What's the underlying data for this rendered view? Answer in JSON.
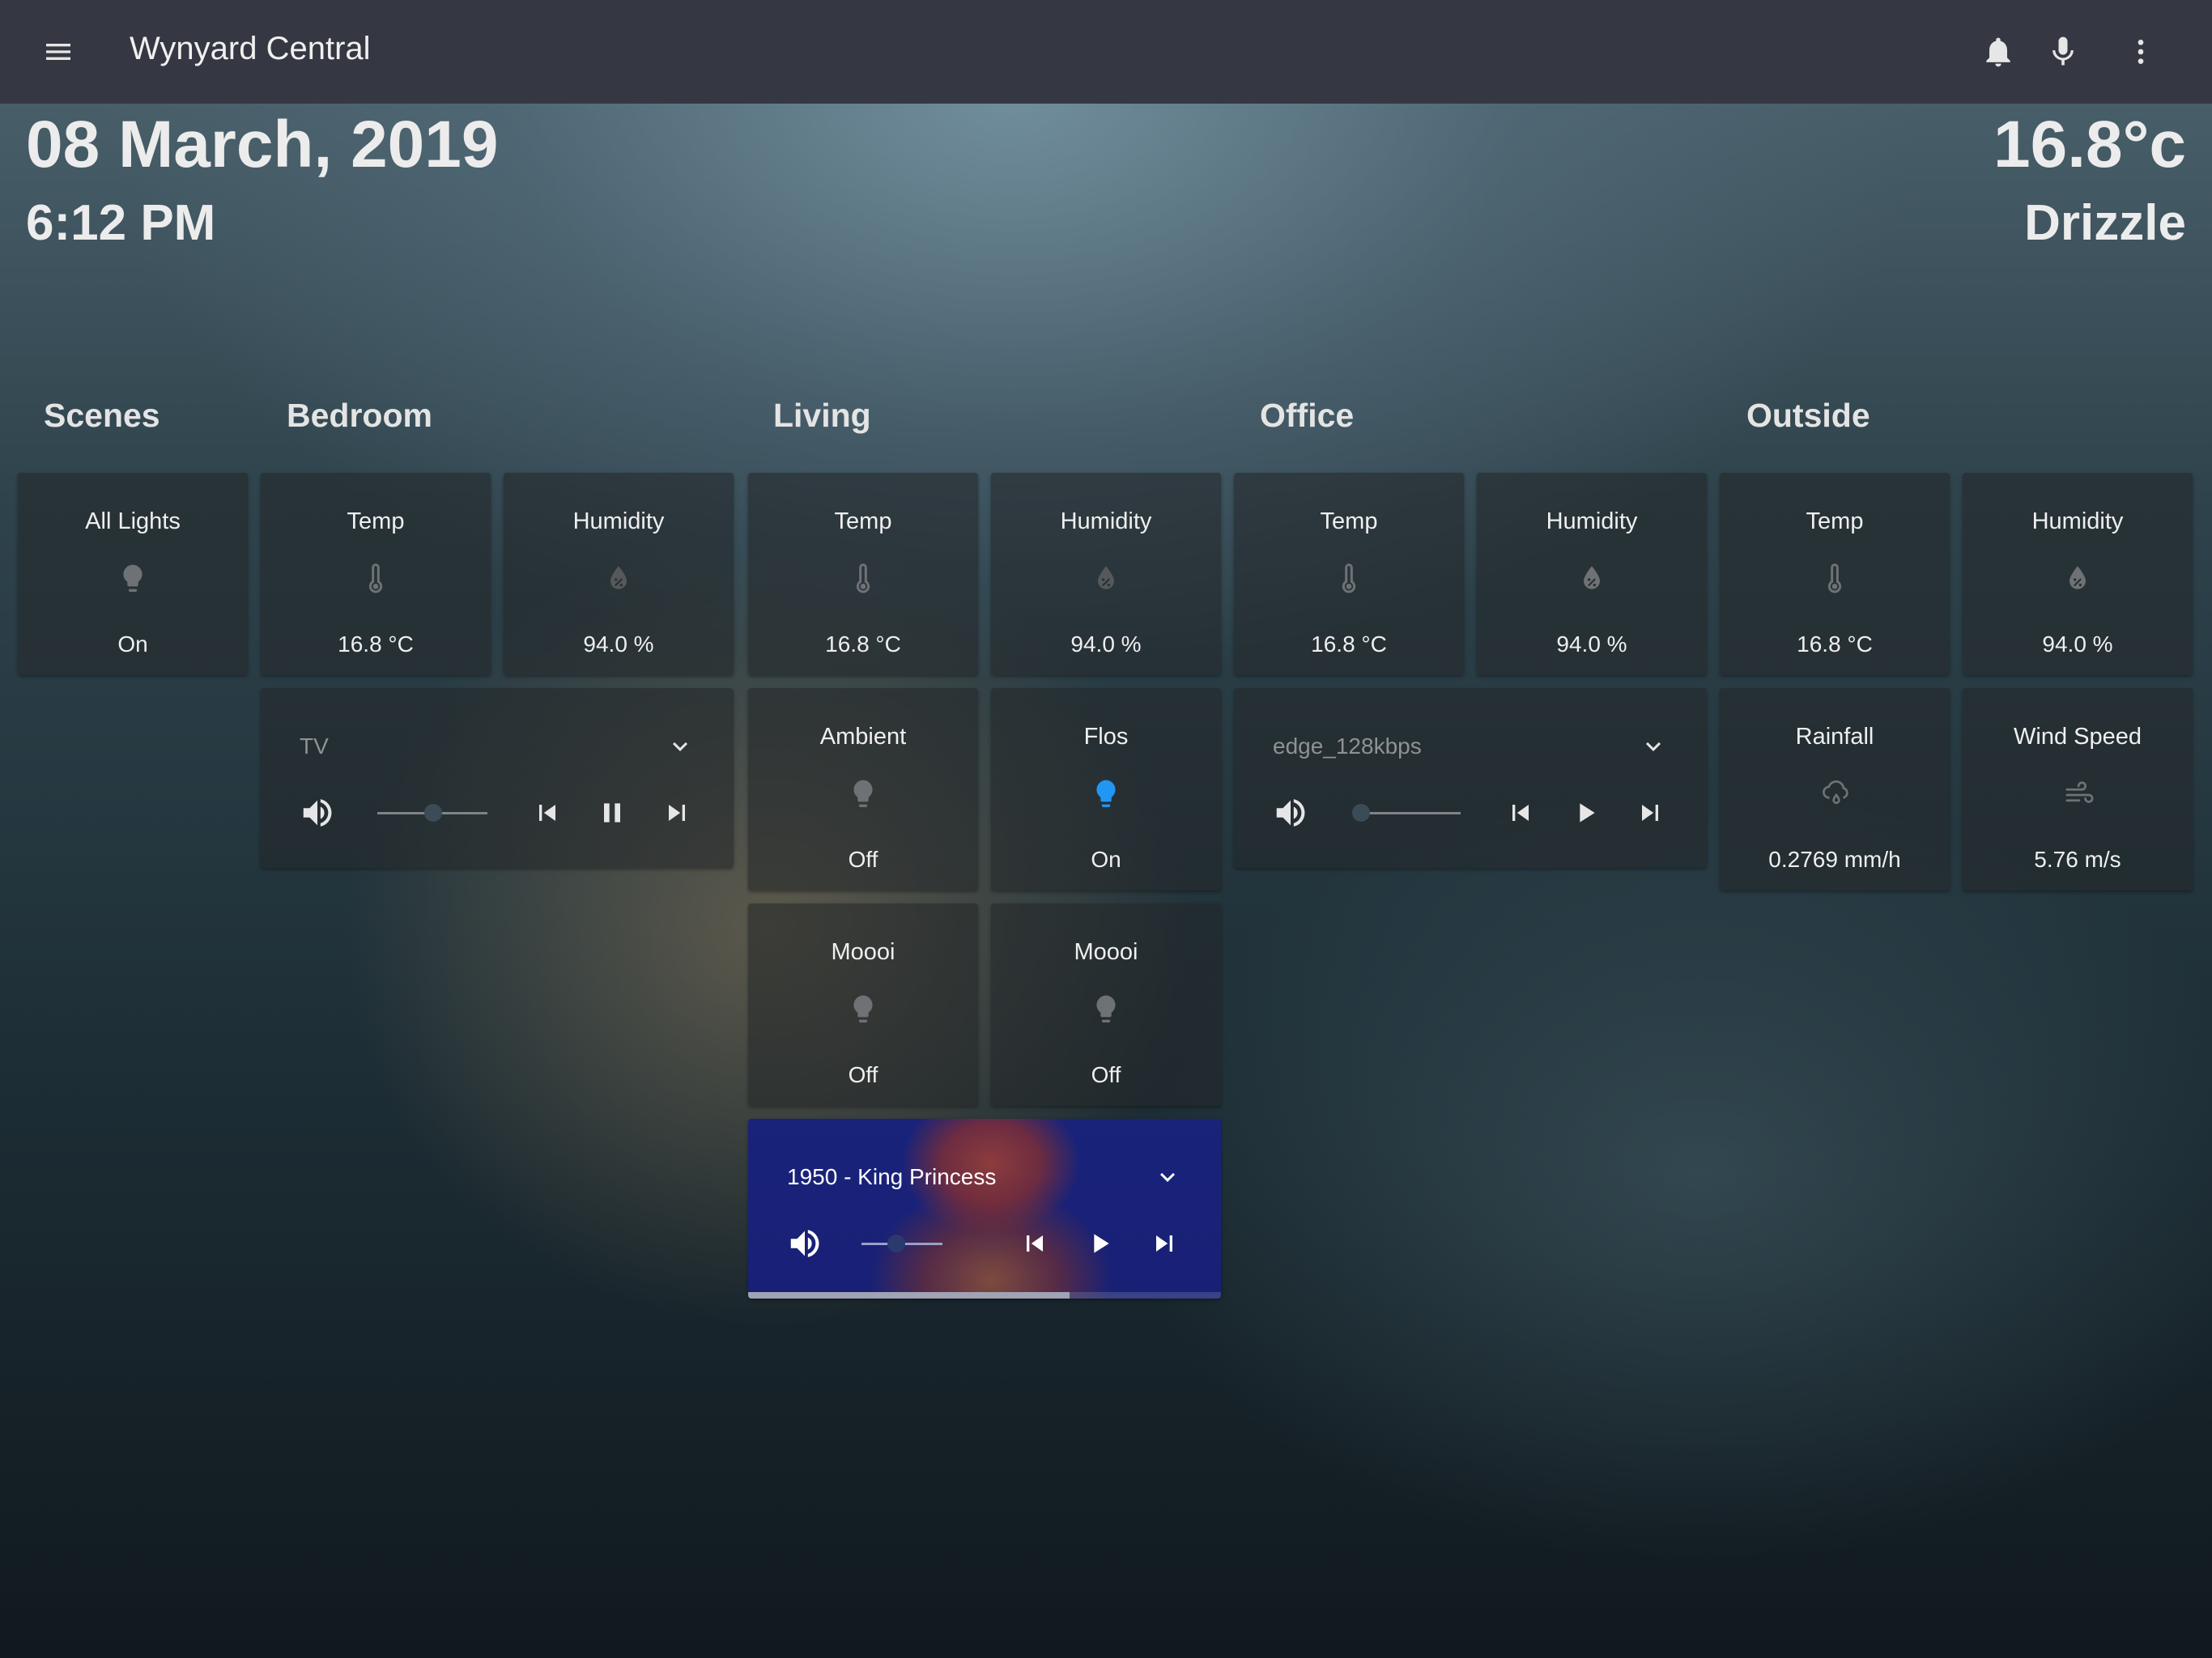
{
  "app": {
    "title": "Wynyard Central"
  },
  "header": {
    "date": "08 March, 2019",
    "time": "6:12 PM",
    "temperature": "16.8°c",
    "condition": "Drizzle"
  },
  "columns": {
    "scenes": "Scenes",
    "bedroom": "Bedroom",
    "living": "Living",
    "office": "Office",
    "outside": "Outside"
  },
  "cards": {
    "all_lights": {
      "name": "All Lights",
      "state": "On",
      "icon": "lightbulb-icon"
    },
    "bedroom_temp": {
      "name": "Temp",
      "state": "16.8 °C",
      "icon": "thermometer-icon"
    },
    "bedroom_humidity": {
      "name": "Humidity",
      "state": "94.0 %",
      "icon": "water-percent-icon"
    },
    "living_temp": {
      "name": "Temp",
      "state": "16.8 °C",
      "icon": "thermometer-icon"
    },
    "living_humidity": {
      "name": "Humidity",
      "state": "94.0 %",
      "icon": "water-percent-icon"
    },
    "living_ambient": {
      "name": "Ambient",
      "state": "Off",
      "icon": "lightbulb-icon"
    },
    "living_flos": {
      "name": "Flos",
      "state": "On",
      "icon": "lightbulb-icon"
    },
    "living_moooi_1": {
      "name": "Moooi",
      "state": "Off",
      "icon": "lightbulb-icon"
    },
    "living_moooi_2": {
      "name": "Moooi",
      "state": "Off",
      "icon": "lightbulb-icon"
    },
    "office_temp": {
      "name": "Temp",
      "state": "16.8 °C",
      "icon": "thermometer-icon"
    },
    "office_humidity": {
      "name": "Humidity",
      "state": "94.0 %",
      "icon": "water-percent-icon"
    },
    "outside_temp": {
      "name": "Temp",
      "state": "16.8 °C",
      "icon": "thermometer-icon"
    },
    "outside_humidity": {
      "name": "Humidity",
      "state": "94.0 %",
      "icon": "water-percent-icon"
    },
    "outside_rainfall": {
      "name": "Rainfall",
      "state": "0.2769 mm/h",
      "icon": "weather-rainy-icon"
    },
    "outside_wind": {
      "name": "Wind Speed",
      "state": "5.76 m/s",
      "icon": "weather-windy-icon"
    }
  },
  "media": {
    "bedroom_tv": {
      "source": "TV",
      "playing": true,
      "volume": 0.5
    },
    "office_radio": {
      "source": "edge_128kbps",
      "playing": false,
      "volume": 0.0
    },
    "living_speaker": {
      "source": "1950 - King Princess",
      "playing": false,
      "volume": 0.3,
      "progress": 0.68
    }
  },
  "colors": {
    "toolbar": "#353842",
    "light_on": "#2196f3",
    "icon_off": "#6e7275"
  }
}
